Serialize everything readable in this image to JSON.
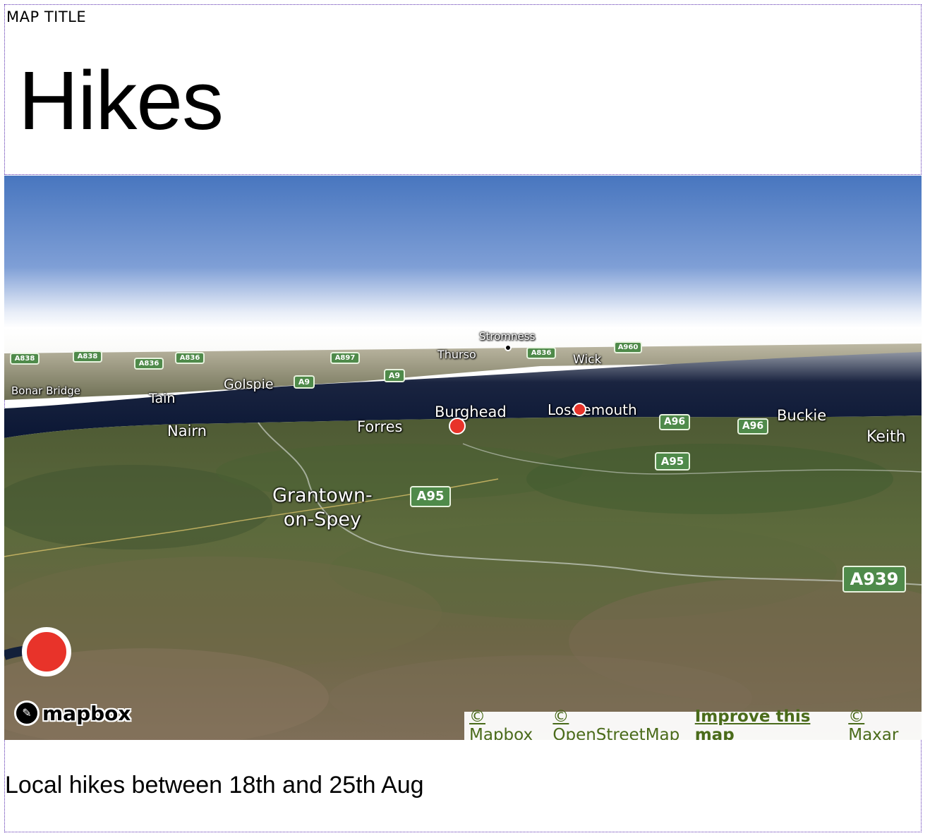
{
  "header": {
    "eyebrow": "MAP TITLE",
    "title": "Hikes"
  },
  "map": {
    "places": [
      {
        "name": "Stromness",
        "kind": "small"
      },
      {
        "name": "Thurso",
        "kind": "small"
      },
      {
        "name": "Wick",
        "kind": "small"
      },
      {
        "name": "Bonar Bridge",
        "kind": "small"
      },
      {
        "name": "Tain",
        "kind": "medium"
      },
      {
        "name": "Golspie",
        "kind": "medium"
      },
      {
        "name": "Nairn",
        "kind": "medium"
      },
      {
        "name": "Forres",
        "kind": "medium"
      },
      {
        "name": "Burghead",
        "kind": "medium"
      },
      {
        "name": "Lossiemouth",
        "kind": "medium"
      },
      {
        "name": "Buckie",
        "kind": "medium"
      },
      {
        "name": "Keith",
        "kind": "medium"
      },
      {
        "name": "Grantown-\non-Spey",
        "kind": "large"
      }
    ],
    "road_shields": [
      "A838",
      "A838",
      "A836",
      "A836",
      "A897",
      "A9",
      "A9",
      "A836",
      "A960",
      "A96",
      "A96",
      "A95",
      "A95",
      "A939"
    ],
    "markers": [
      "hike-marker-burghead",
      "hike-marker-lossiemouth",
      "hike-marker-foreground"
    ],
    "logo": {
      "text": "mapbox",
      "icon": "mapbox-logo-icon"
    },
    "attribution": {
      "mapbox": "© Mapbox",
      "osm": "© OpenStreetMap",
      "improve": "Improve this map",
      "maxar": "© Maxar"
    },
    "colors": {
      "sky": "#4b79c1",
      "sea": "#0c1a3a",
      "land": "#6a6a46",
      "marker": "#e8332a",
      "shield": "#4f8a4a",
      "link": "#4a6b1a"
    }
  },
  "caption": "Local hikes between 18th and 25th Aug"
}
